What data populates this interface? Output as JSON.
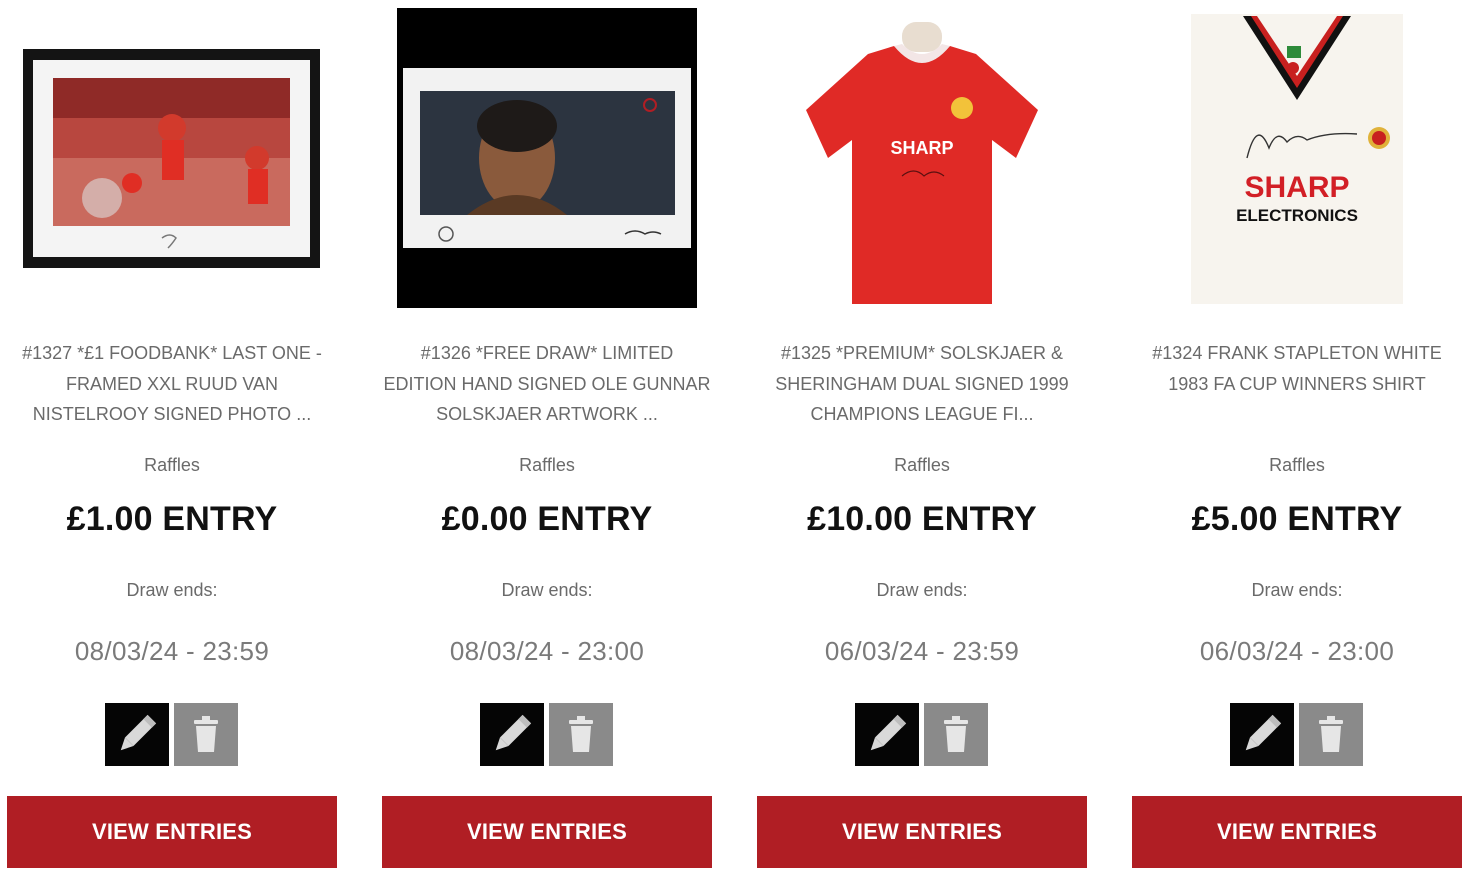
{
  "raffles": [
    {
      "title_lines": [
        "#1327 *£1 FOODBANK* LAST ONE -",
        "FRAMED XXL RUUD VAN",
        "NISTELROOY SIGNED PHOTO ..."
      ],
      "category": "Raffles",
      "price": "£1.00 ENTRY",
      "ends_label": "Draw ends:",
      "ends_date": "08/03/24 - 23:59",
      "view_label": "VIEW ENTRIES",
      "image_icon": "framed-signed-photo"
    },
    {
      "title_lines": [
        "#1326 *FREE DRAW* LIMITED",
        "EDITION HAND SIGNED OLE GUNNAR",
        "SOLSKJAER ARTWORK ..."
      ],
      "category": "Raffles",
      "price": "£0.00 ENTRY",
      "ends_label": "Draw ends:",
      "ends_date": "08/03/24 - 23:00",
      "view_label": "VIEW ENTRIES",
      "image_icon": "signed-artwork-print"
    },
    {
      "title_lines": [
        "#1325 *PREMIUM* SOLSKJAER &",
        "SHERINGHAM DUAL SIGNED 1999",
        "CHAMPIONS LEAGUE FI..."
      ],
      "category": "Raffles",
      "price": "£10.00 ENTRY",
      "ends_label": "Draw ends:",
      "ends_date": "06/03/24 - 23:59",
      "view_label": "VIEW ENTRIES",
      "image_icon": "red-signed-shirt",
      "shirt_sponsor": "SHARP"
    },
    {
      "title_lines": [
        "#1324 FRANK STAPLETON WHITE",
        "1983 FA CUP WINNERS SHIRT"
      ],
      "category": "Raffles",
      "price": "£5.00 ENTRY",
      "ends_label": "Draw ends:",
      "ends_date": "06/03/24 - 23:00",
      "view_label": "VIEW ENTRIES",
      "image_icon": "white-signed-shirt",
      "shirt_sponsor": "SHARP",
      "shirt_sponsor_sub": "ELECTRONICS"
    }
  ],
  "colors": {
    "accent": "#b01e24",
    "edit_button": "#050505",
    "delete_button": "#8a8a8a",
    "muted_text": "#6a6a6a"
  },
  "icons": {
    "edit": "pencil-icon",
    "delete": "trash-icon"
  }
}
